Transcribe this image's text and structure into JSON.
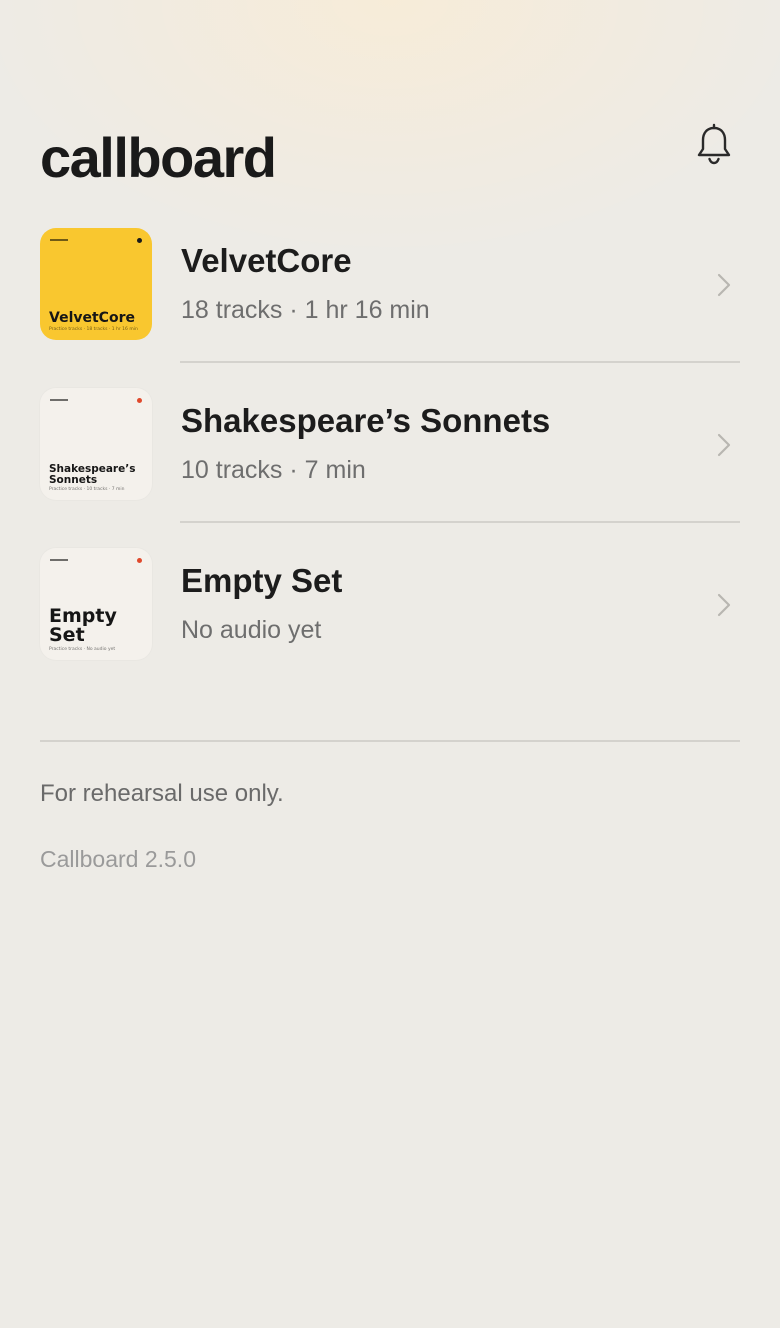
{
  "app": {
    "title": "callboard"
  },
  "icons": {
    "notifications": "bell-icon",
    "row_chevron": "chevron-right-icon"
  },
  "colors": {
    "background": "#edebe6",
    "yellow_cover": "#f9c72f",
    "cream_cover": "#f4f1ec",
    "accent_dot": "#e0492c",
    "text_primary": "#1c1c1c",
    "text_secondary": "#6e6e6e"
  },
  "shows": [
    {
      "title": "VelvetCore",
      "subtitle": "18 tracks · 1 hr 16 min",
      "cover": {
        "title": "VelvetCore",
        "subtitle": "Practice tracks · 18 tracks · 1 hr 16 min",
        "style": "yellow"
      }
    },
    {
      "title": "Shakespeare’s Sonnets",
      "subtitle": "10 tracks · 7 min",
      "cover": {
        "title": "Shakespeare’s Sonnets",
        "subtitle": "Practice tracks · 10 tracks · 7 min",
        "style": "cream"
      }
    },
    {
      "title": "Empty Set",
      "subtitle": "No audio yet",
      "cover": {
        "title": "Empty Set",
        "subtitle": "Practice tracks · No audio yet",
        "style": "cream"
      }
    }
  ],
  "footer": {
    "disclaimer": "For rehearsal use only.",
    "version": "Callboard 2.5.0"
  }
}
